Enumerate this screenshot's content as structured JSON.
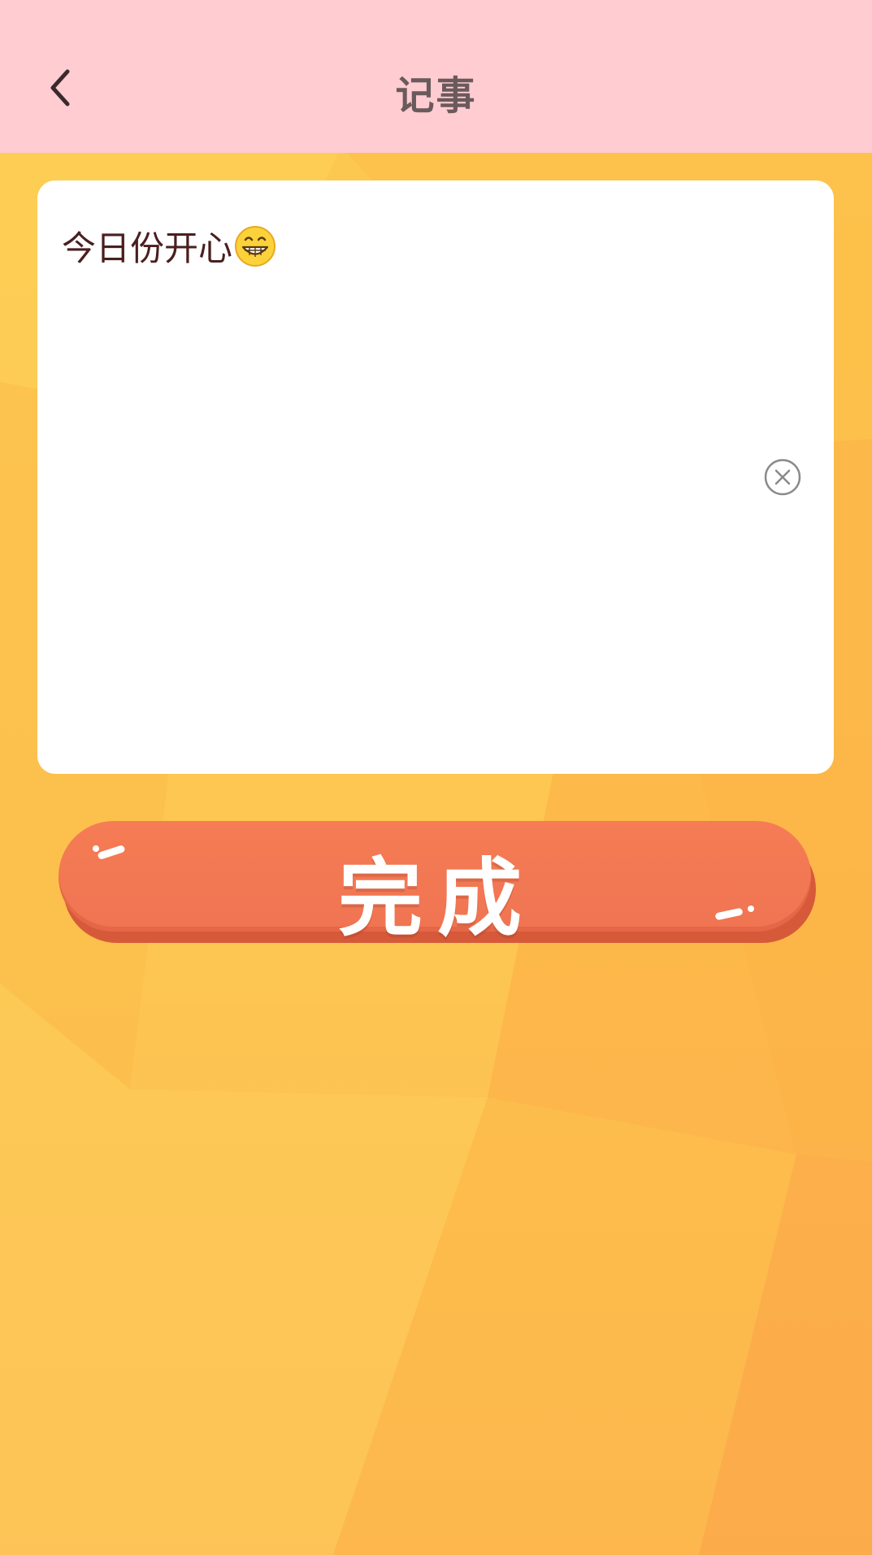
{
  "header": {
    "title": "记事",
    "back_icon": "chevron-left-icon"
  },
  "note": {
    "text": "今日份开心",
    "emoji": "grinning-face-icon",
    "clear_icon": "clear-circle-icon"
  },
  "actions": {
    "done_label": "完成"
  },
  "colors": {
    "header_bg": "#ffccd1",
    "background": "#fdc04b",
    "button": "#f07452",
    "text_dark": "#4a1f1f"
  }
}
